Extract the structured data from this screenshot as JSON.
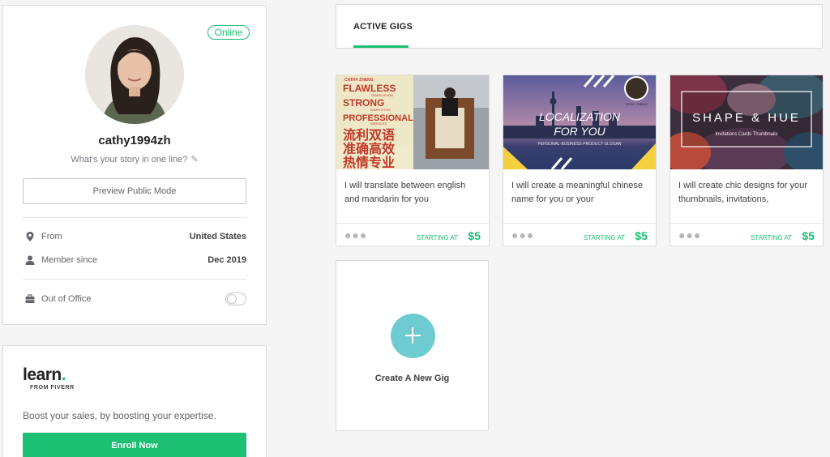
{
  "profile": {
    "status": "Online",
    "username": "cathy1994zh",
    "tagline": "What's your story in one line?",
    "preview_button": "Preview Public Mode",
    "from_label": "From",
    "from_value": "United States",
    "member_label": "Member since",
    "member_value": "Dec 2019",
    "out_of_office_label": "Out of Office"
  },
  "learn": {
    "logo_word": "learn",
    "logo_sub": "FROM FIVERR",
    "text": "Boost your sales, by boosting your expertise.",
    "enroll_button": "Enroll Now"
  },
  "tabs": {
    "active": "ACTIVE GIGS"
  },
  "gigs": [
    {
      "title": "I will translate between english and mandarin for you",
      "starting_label": "STARTING AT",
      "price": "$5",
      "thumb_text": [
        "CATHY ZHENG",
        "FLAWLESS",
        "TRANSLATION",
        "STRONG",
        "WORK ETHIC",
        "PROFESSIONAL",
        "SERVICES",
        "流利双语",
        "准确高效",
        "热情专业"
      ]
    },
    {
      "title": "I will create a meaningful chinese name for you or your",
      "starting_label": "STARTING AT",
      "price": "$5",
      "thumb_text": [
        "LOCALIZATION",
        "FOR YOU",
        "PERSONAL·BUSINESS·PRODUCT·SLOGAN",
        "CATHY ZHENG"
      ]
    },
    {
      "title": "I will create chic designs for your thumbnails, invitations,",
      "starting_label": "STARTING AT",
      "price": "$5",
      "thumb_text": [
        "SHAPE & HUE",
        "Invitations Cards Thumbnails"
      ]
    }
  ],
  "new_gig": {
    "label": "Create A New Gig"
  },
  "colors": {
    "accent": "#1dbf73",
    "plus_circle": "#6ecbd2"
  }
}
